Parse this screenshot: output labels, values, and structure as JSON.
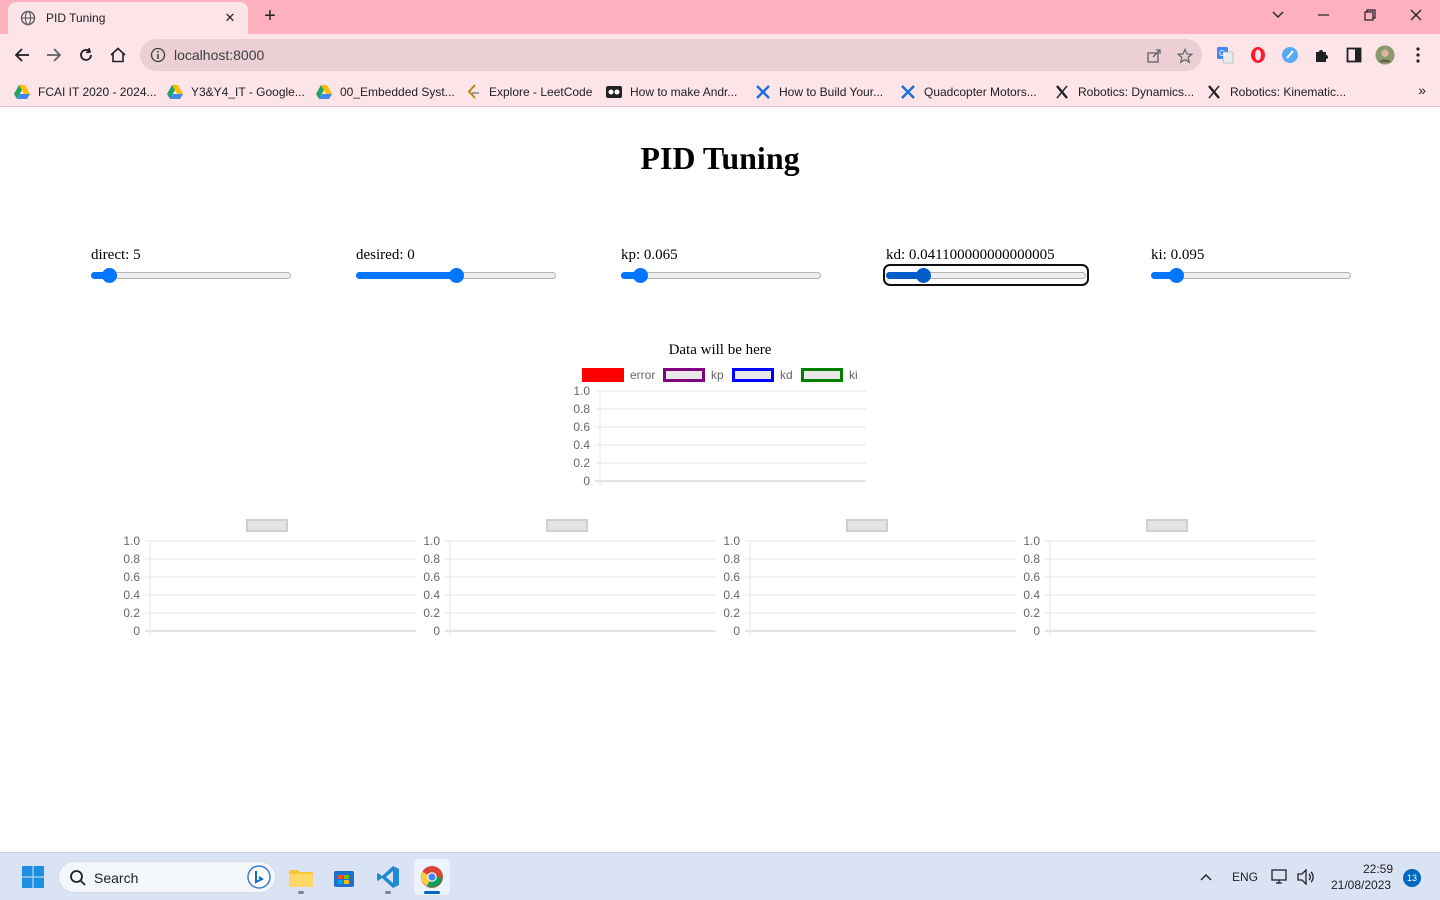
{
  "browser": {
    "tab_title": "PID Tuning",
    "address": "localhost:8000",
    "new_tab_symbol": "+",
    "close_symbol": "✕",
    "bookmarks": [
      {
        "label": "FCAI IT 2020 - 2024...",
        "icon": "google-drive-icon"
      },
      {
        "label": "Y3&Y4_IT - Google...",
        "icon": "google-drive-icon"
      },
      {
        "label": "00_Embedded Syst...",
        "icon": "google-drive-icon"
      },
      {
        "label": "Explore - LeetCode",
        "icon": "leetcode-icon"
      },
      {
        "label": "How to make Andr...",
        "icon": "video-icon"
      },
      {
        "label": "How to Build Your...",
        "icon": "drone-icon"
      },
      {
        "label": "Quadcopter Motors...",
        "icon": "drone-icon"
      },
      {
        "label": "Robotics: Dynamics...",
        "icon": "x-brand-icon"
      },
      {
        "label": "Robotics: Kinematic...",
        "icon": "x-brand-icon"
      }
    ],
    "more_bookmarks": "»"
  },
  "page": {
    "title": "PID Tuning",
    "sliders": [
      {
        "label": "direct: 5",
        "value_fraction": 0.06
      },
      {
        "label": "desired: 0",
        "value_fraction": 0.5
      },
      {
        "label": "kp: 0.065",
        "value_fraction": 0.065
      },
      {
        "label": "kd: 0.041100000000000005",
        "value_fraction": 0.16
      },
      {
        "label": "ki: 0.095",
        "value_fraction": 0.095
      }
    ],
    "chart_title": "Data will be here"
  },
  "chart_data": [
    {
      "type": "line",
      "title": "Data will be here",
      "series": [
        {
          "name": "error",
          "values": [],
          "color": "#ff0000"
        },
        {
          "name": "kp",
          "values": [],
          "color": "#800080"
        },
        {
          "name": "kd",
          "values": [],
          "color": "#0000ff"
        },
        {
          "name": "ki",
          "values": [],
          "color": "#008000"
        }
      ],
      "yticks": [
        "1.0",
        "0.8",
        "0.6",
        "0.4",
        "0.2",
        "0"
      ],
      "ylim": [
        0,
        1
      ],
      "grid": true,
      "legend_position": "top"
    },
    {
      "type": "line",
      "series": [],
      "yticks": [
        "1.0",
        "0.8",
        "0.6",
        "0.4",
        "0.2",
        "0"
      ],
      "ylim": [
        0,
        1
      ],
      "grid": true,
      "legend_position": "top"
    },
    {
      "type": "line",
      "series": [],
      "yticks": [
        "1.0",
        "0.8",
        "0.6",
        "0.4",
        "0.2",
        "0"
      ],
      "ylim": [
        0,
        1
      ],
      "grid": true,
      "legend_position": "top"
    },
    {
      "type": "line",
      "series": [],
      "yticks": [
        "1.0",
        "0.8",
        "0.6",
        "0.4",
        "0.2",
        "0"
      ],
      "ylim": [
        0,
        1
      ],
      "grid": true,
      "legend_position": "top"
    },
    {
      "type": "line",
      "series": [],
      "yticks": [
        "1.0",
        "0.8",
        "0.6",
        "0.4",
        "0.2",
        "0"
      ],
      "ylim": [
        0,
        1
      ],
      "grid": true,
      "legend_position": "top"
    }
  ],
  "taskbar": {
    "search_label": "Search",
    "language": "ENG",
    "time": "22:59",
    "date": "21/08/2023",
    "notification_count": "13",
    "apps": [
      "windows-start-icon",
      "file-explorer-icon",
      "microsoft-store-icon",
      "vscode-icon",
      "chrome-icon"
    ]
  },
  "colors": {
    "chrome_tabbar": "#fdb1bf",
    "chrome_toolbar": "#fce4e8",
    "slider_accent": "#0075ff",
    "error": "#ff0000",
    "kp": "#800080",
    "kd": "#0000ff",
    "ki": "#008000"
  }
}
